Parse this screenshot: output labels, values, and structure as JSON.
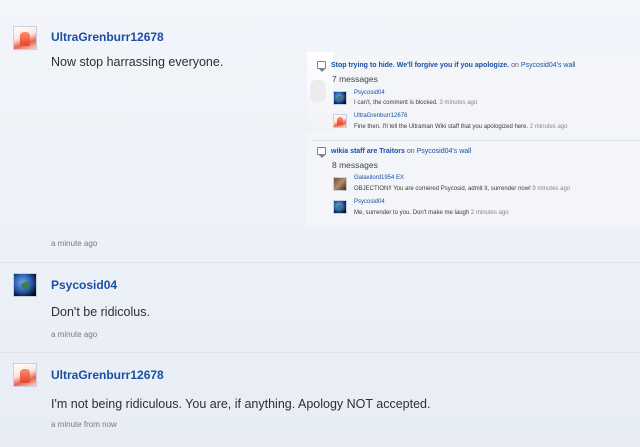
{
  "posts": [
    {
      "username": "UltraGrenburr12678",
      "message": "Now stop harrassing everyone.",
      "time": "a minute ago",
      "avatar_icon": "ultraman-avatar"
    },
    {
      "username": "Psycosid04",
      "message": "Don't be ridicolus.",
      "time": "a minute ago",
      "avatar_icon": "earth-avatar"
    },
    {
      "username": "UltraGrenburr12678",
      "message": "I'm not being ridiculous. You are, if anything. Apology NOT accepted.",
      "time": "a minute from now",
      "avatar_icon": "ultraman-avatar"
    }
  ],
  "activity": {
    "threads": [
      {
        "title": "Stop trying to hide. We'll forgive you if you apologize.",
        "on": "on",
        "wall": "Psycosid04's wall",
        "count": "7 messages",
        "replies": [
          {
            "user": "Psycosid04",
            "text": "I can't, the comment is blocked.",
            "time": "3 minutes ago",
            "avatar": "earth"
          },
          {
            "user": "UltraGrenburr12678",
            "text": "Fine then. I'll tell the Ultraman Wiki staff that you apologized here.",
            "time": "2 minutes ago",
            "avatar": "ultra"
          }
        ]
      },
      {
        "title": "wikia staff are Traitors",
        "on": "on",
        "wall": "Psycosid04's wall",
        "count": "8 messages",
        "replies": [
          {
            "user": "Galaxilord1954 EX",
            "text": "OBJECTION!! You are cornered Psycosid, admit it, surrender now!",
            "time": "9 minutes ago",
            "avatar": "galaxy"
          },
          {
            "user": "Psycosid04",
            "text": "Me, surrender to you. Don't make me laugh",
            "time": "2 minutes ago",
            "avatar": "earth"
          }
        ]
      }
    ]
  },
  "colors": {
    "link": "#1a4fa5",
    "background": "#eef2f8",
    "divider": "#dfe4ec"
  }
}
